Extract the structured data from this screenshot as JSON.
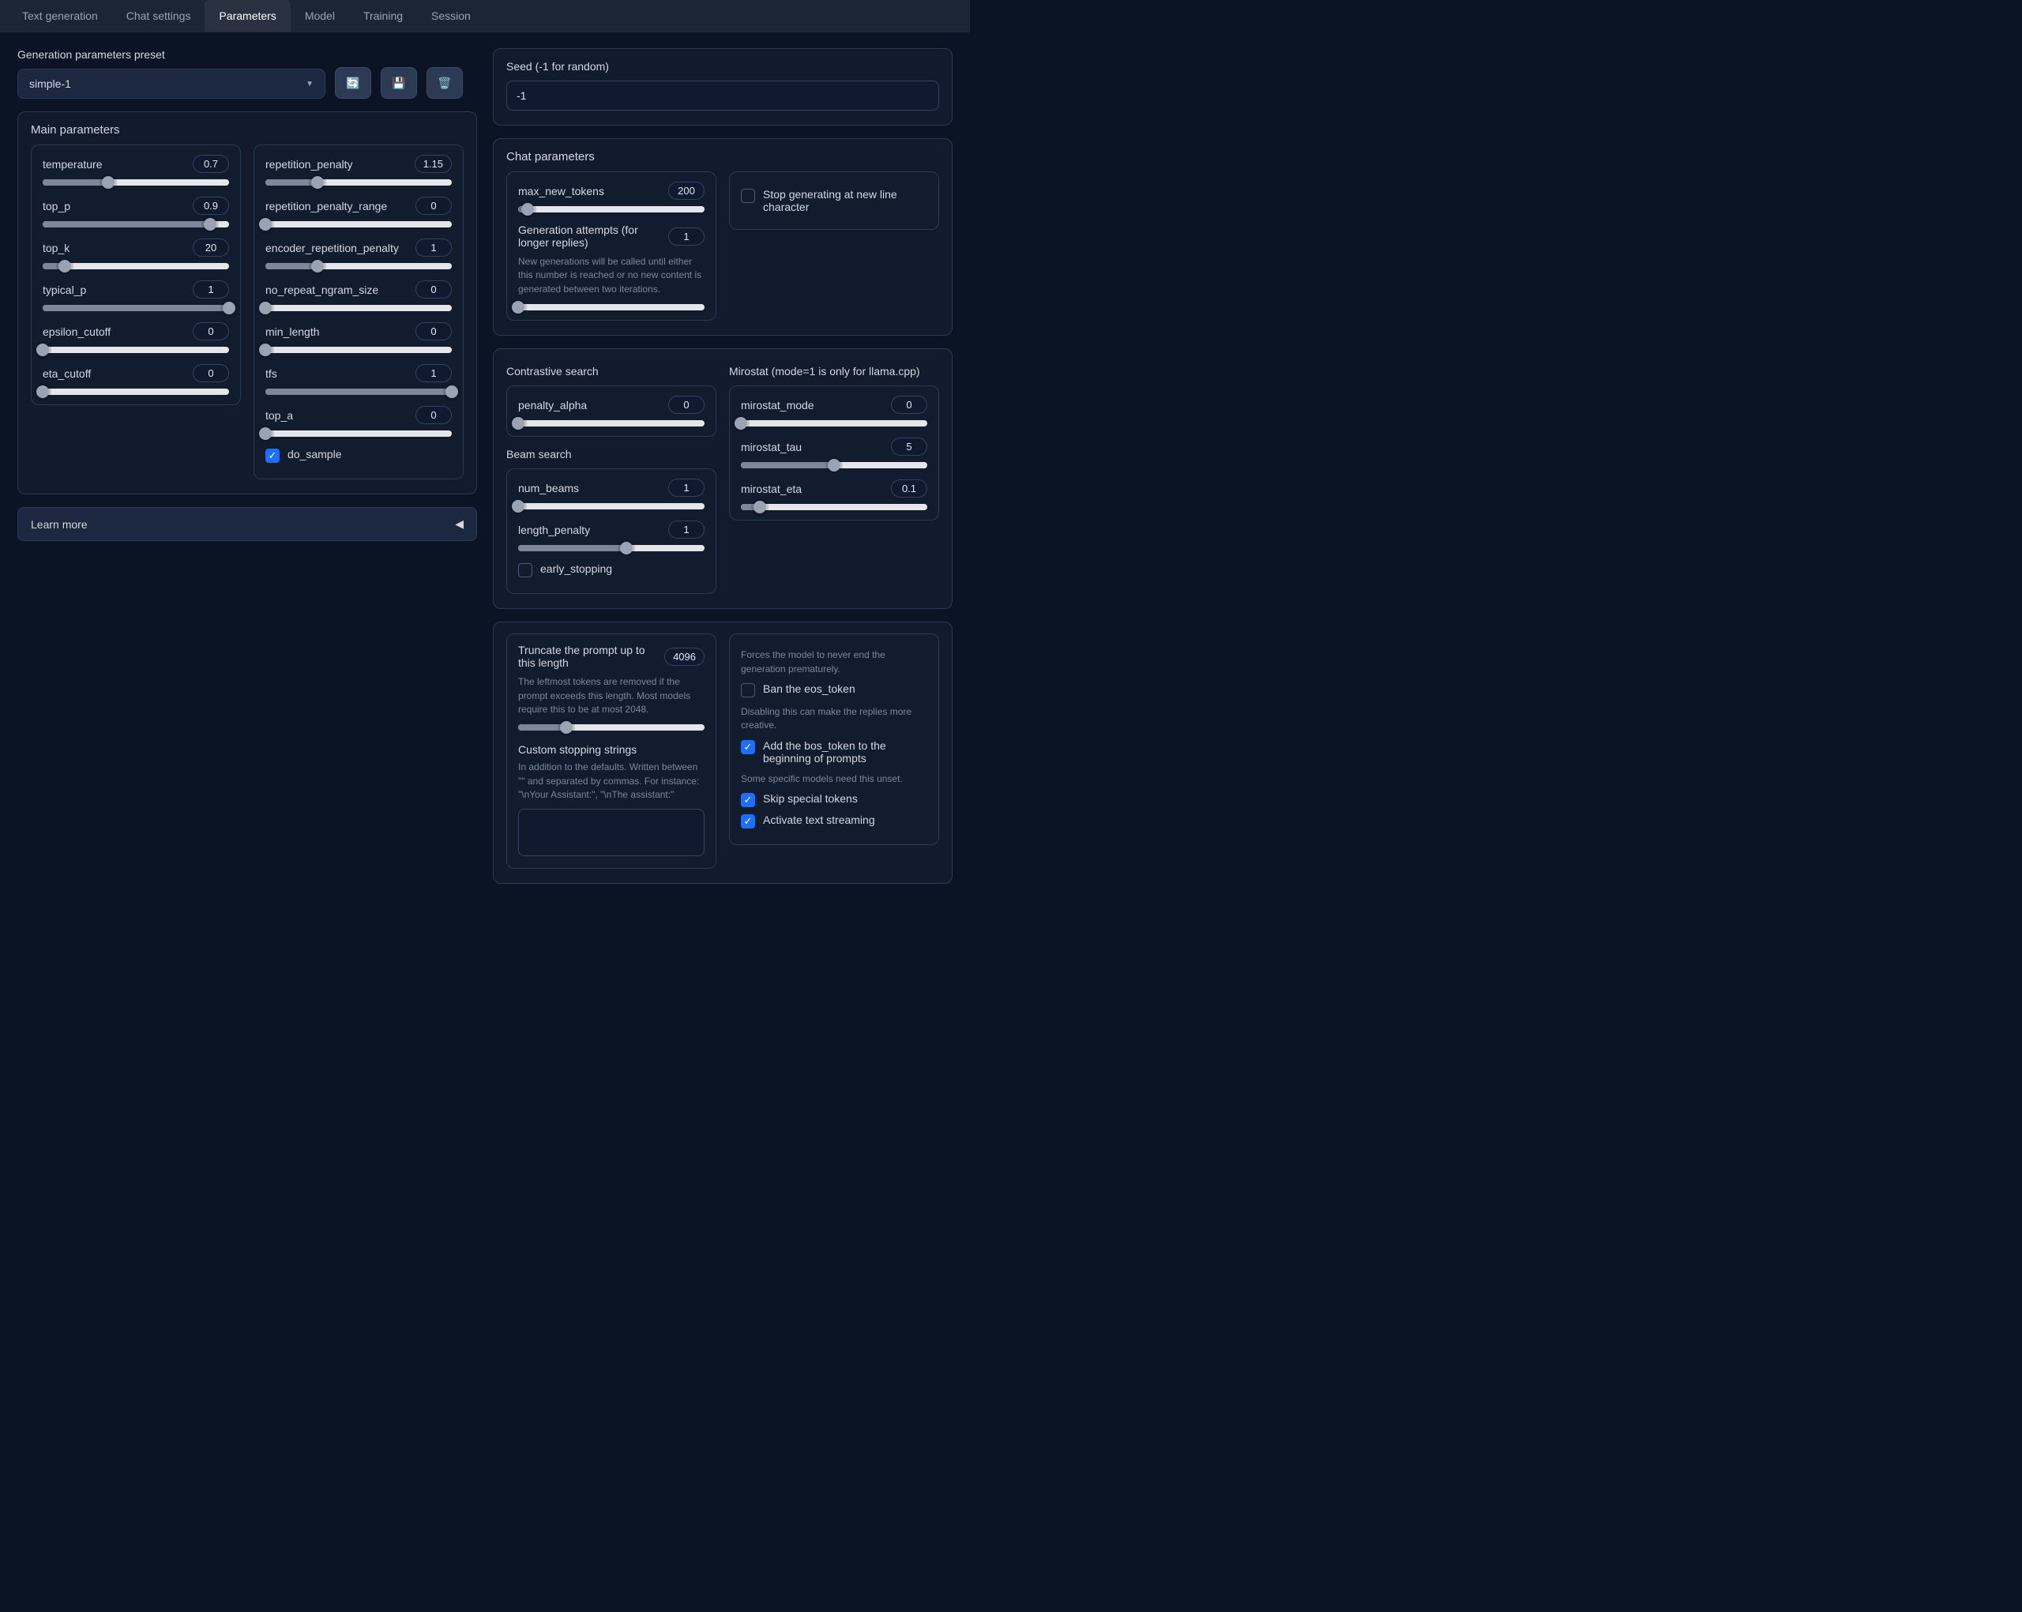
{
  "tabs": [
    "Text generation",
    "Chat settings",
    "Parameters",
    "Model",
    "Training",
    "Session"
  ],
  "active_tab": 2,
  "preset": {
    "label": "Generation parameters preset",
    "value": "simple-1",
    "icons": [
      "refresh-icon",
      "save-icon",
      "delete-icon"
    ]
  },
  "seed": {
    "label": "Seed (-1 for random)",
    "value": "-1"
  },
  "main_title": "Main parameters",
  "left_sliders": [
    {
      "name": "temperature",
      "value": "0.7",
      "pct": 35
    },
    {
      "name": "top_p",
      "value": "0.9",
      "pct": 90
    },
    {
      "name": "top_k",
      "value": "20",
      "pct": 12
    },
    {
      "name": "typical_p",
      "value": "1",
      "pct": 100
    },
    {
      "name": "epsilon_cutoff",
      "value": "0",
      "pct": 0
    },
    {
      "name": "eta_cutoff",
      "value": "0",
      "pct": 0
    }
  ],
  "left_sliders2": [
    {
      "name": "repetition_penalty",
      "value": "1.15",
      "pct": 28
    },
    {
      "name": "repetition_penalty_range",
      "value": "0",
      "pct": 0
    },
    {
      "name": "encoder_repetition_penalty",
      "value": "1",
      "pct": 28
    },
    {
      "name": "no_repeat_ngram_size",
      "value": "0",
      "pct": 0
    },
    {
      "name": "min_length",
      "value": "0",
      "pct": 0
    },
    {
      "name": "tfs",
      "value": "1",
      "pct": 100
    },
    {
      "name": "top_a",
      "value": "0",
      "pct": 0
    }
  ],
  "do_sample": {
    "label": "do_sample",
    "checked": true
  },
  "learn_more": "Learn more",
  "chat_title": "Chat parameters",
  "chat": {
    "max_new_tokens": {
      "name": "max_new_tokens",
      "value": "200",
      "pct": 5
    },
    "gen_attempts": {
      "name": "Generation attempts (for longer replies)",
      "value": "1",
      "pct": 0,
      "help": "New generations will be called until either this number is reached or no new content is generated between two iterations."
    },
    "stop_newline": {
      "label": "Stop generating at new line character",
      "checked": false
    }
  },
  "contrastive_title": "Contrastive search",
  "contrastive": {
    "penalty_alpha": {
      "name": "penalty_alpha",
      "value": "0",
      "pct": 0
    }
  },
  "beam_title": "Beam search",
  "beam": {
    "num_beams": {
      "name": "num_beams",
      "value": "1",
      "pct": 0
    },
    "length_penalty": {
      "name": "length_penalty",
      "value": "1",
      "pct": 58
    },
    "early_stopping": {
      "label": "early_stopping",
      "checked": false
    }
  },
  "mirostat_title": "Mirostat (mode=1 is only for llama.cpp)",
  "mirostat": {
    "mode": {
      "name": "mirostat_mode",
      "value": "0",
      "pct": 0
    },
    "tau": {
      "name": "mirostat_tau",
      "value": "5",
      "pct": 50
    },
    "eta": {
      "name": "mirostat_eta",
      "value": "0.1",
      "pct": 10
    }
  },
  "truncate": {
    "name": "Truncate the prompt up to this length",
    "value": "4096",
    "pct": 26,
    "help": "The leftmost tokens are removed if the prompt exceeds this length. Most models require this to be at most 2048."
  },
  "custom_stop": {
    "name": "Custom stopping strings",
    "help": "In addition to the defaults. Written between \"\" and separated by commas. For instance: \"\\nYour Assistant:\", \"\\nThe assistant:\""
  },
  "forces_help": "Forces the model to never end the generation prematurely.",
  "ban_eos": {
    "label": "Ban the eos_token",
    "checked": false
  },
  "disabling_help": "Disabling this can make the replies more creative.",
  "add_bos": {
    "label": "Add the bos_token to the beginning of prompts",
    "checked": true
  },
  "specific_help": "Some specific models need this unset.",
  "skip_special": {
    "label": "Skip special tokens",
    "checked": true
  },
  "activate_stream": {
    "label": "Activate text streaming",
    "checked": true
  }
}
